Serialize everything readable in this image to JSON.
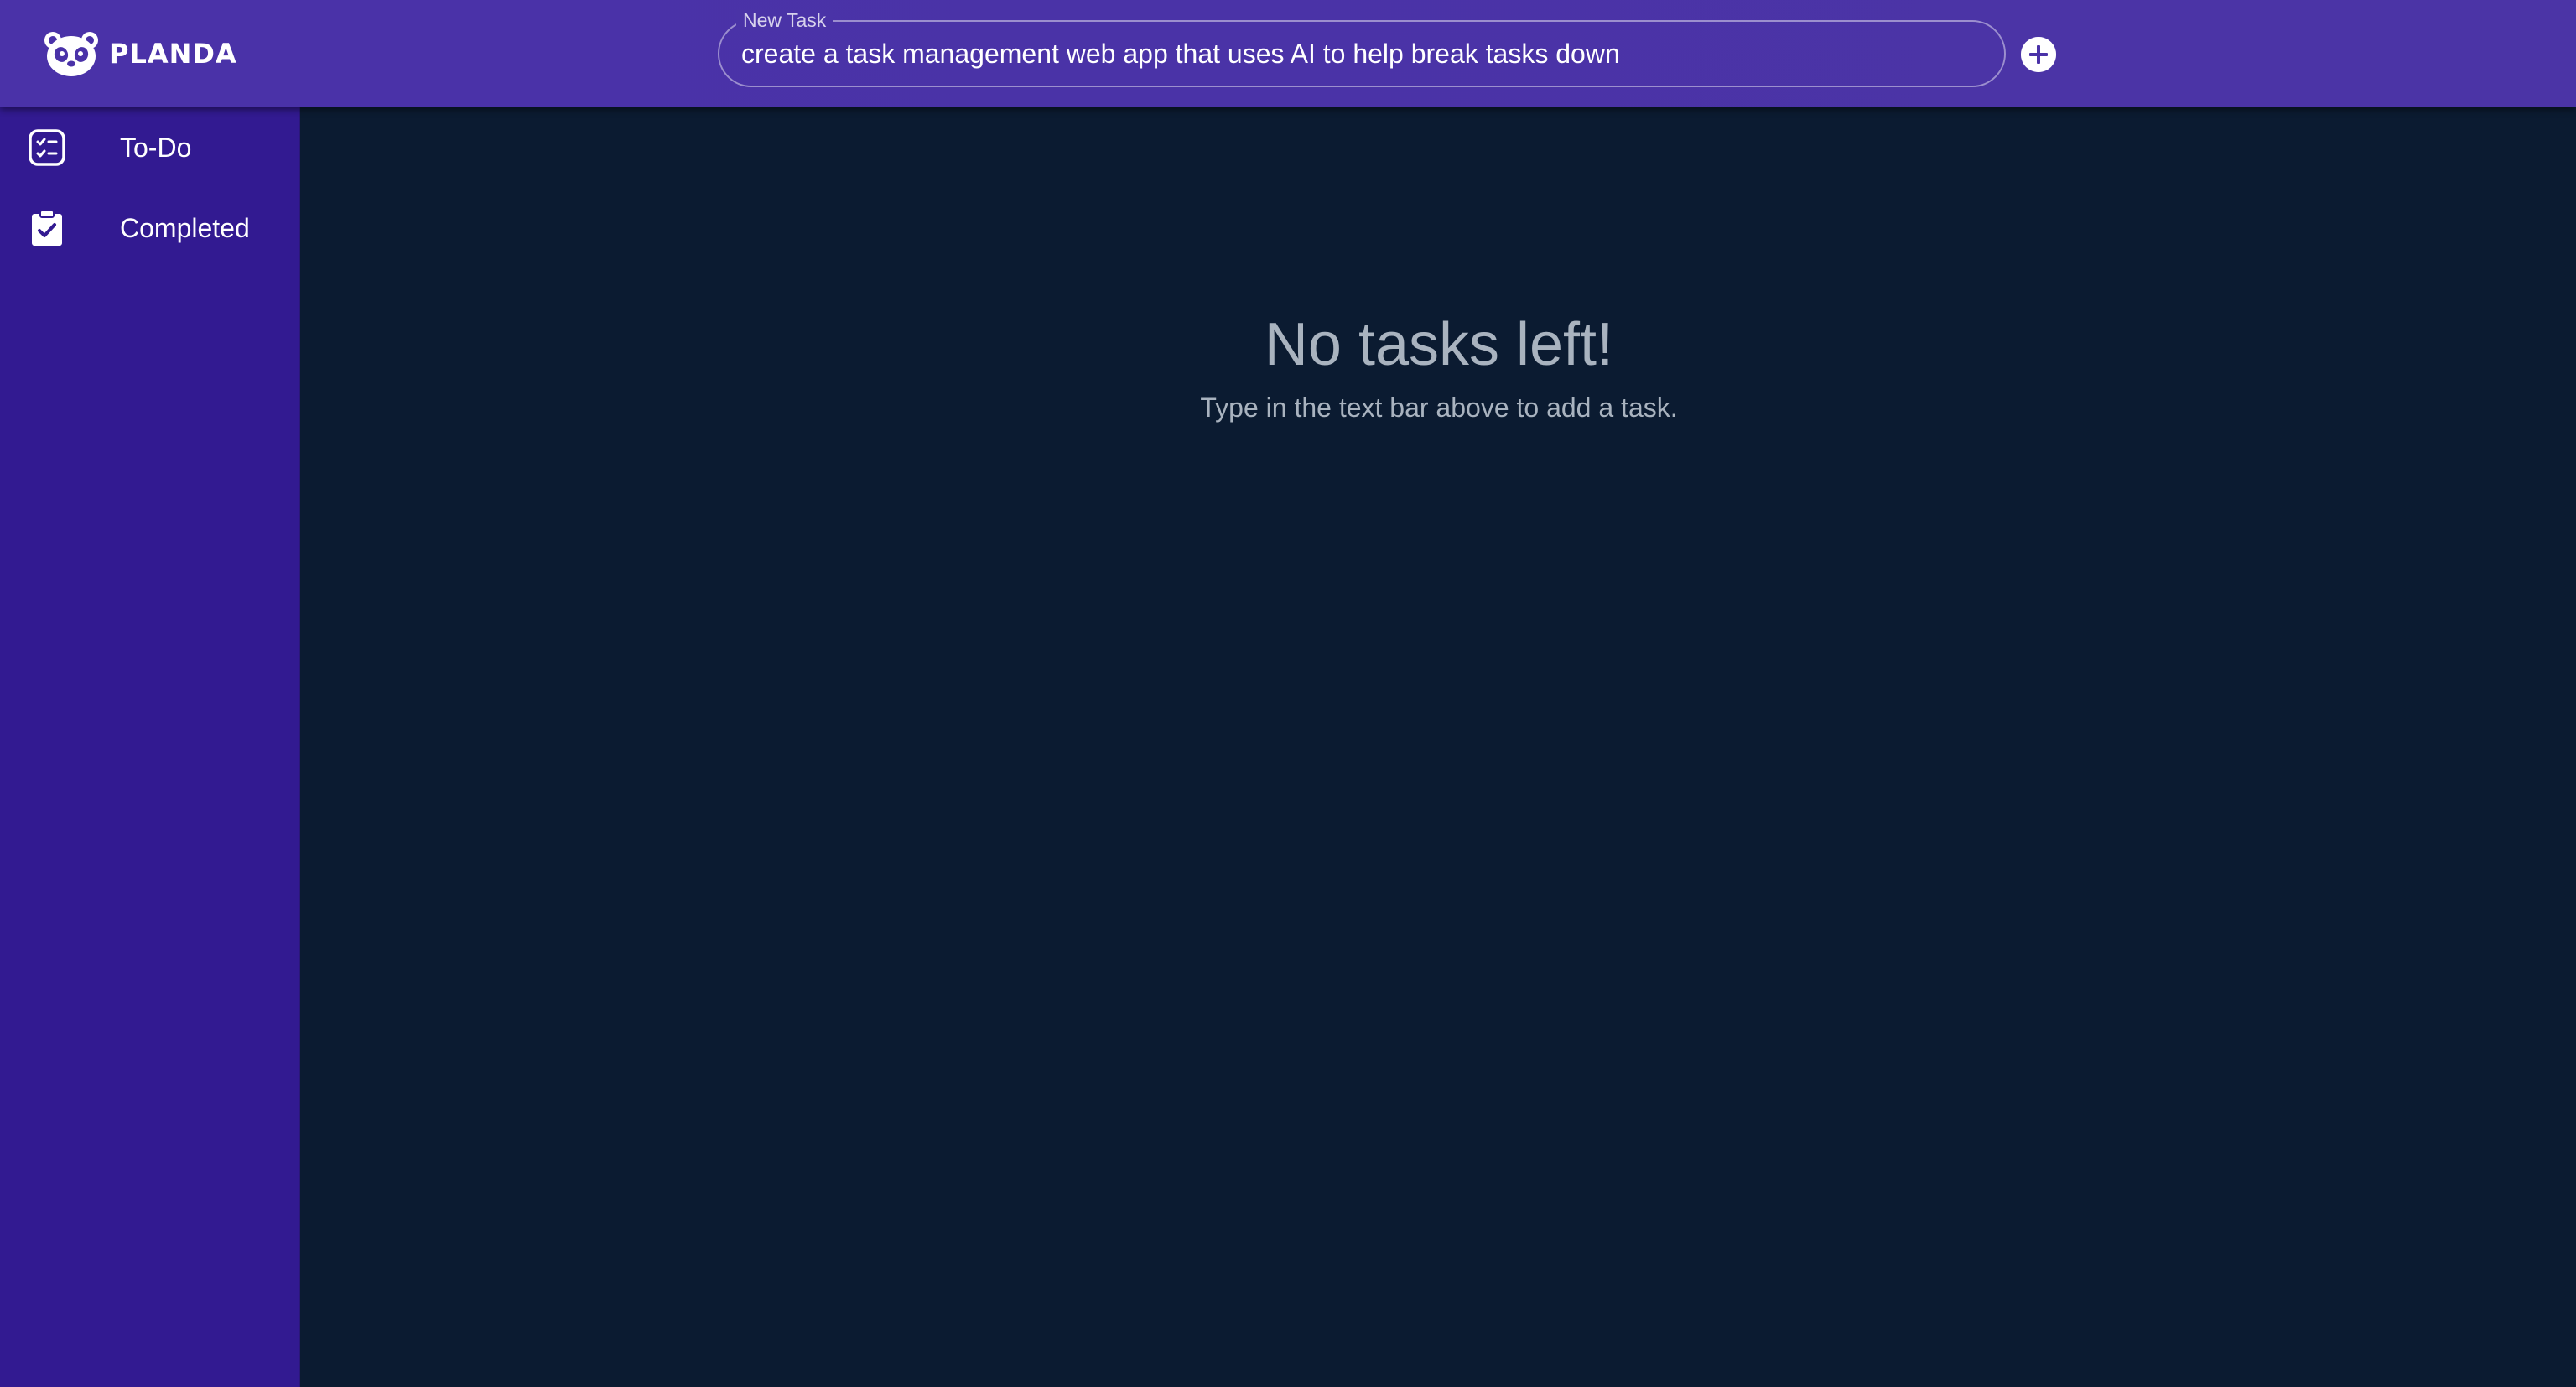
{
  "app": {
    "logo_text": "PLANDA",
    "logo_icon": "panda-face-icon"
  },
  "header": {
    "task_field_label": "New Task",
    "task_input_value": "create a task management web app that uses AI to help break tasks down",
    "add_button_icon": "plus-circle-icon"
  },
  "sidebar": {
    "items": [
      {
        "label": "To-Do",
        "icon": "checklist-icon"
      },
      {
        "label": "Completed",
        "icon": "clipboard-check-icon"
      }
    ]
  },
  "main": {
    "empty_title": "No tasks left!",
    "empty_subtitle": "Type in the text bar above to add a task."
  },
  "colors": {
    "header_bg": "#4a32a8",
    "sidebar_bg": "#321a91",
    "main_bg": "#0b1b31",
    "muted_text": "#a9b3bf"
  }
}
